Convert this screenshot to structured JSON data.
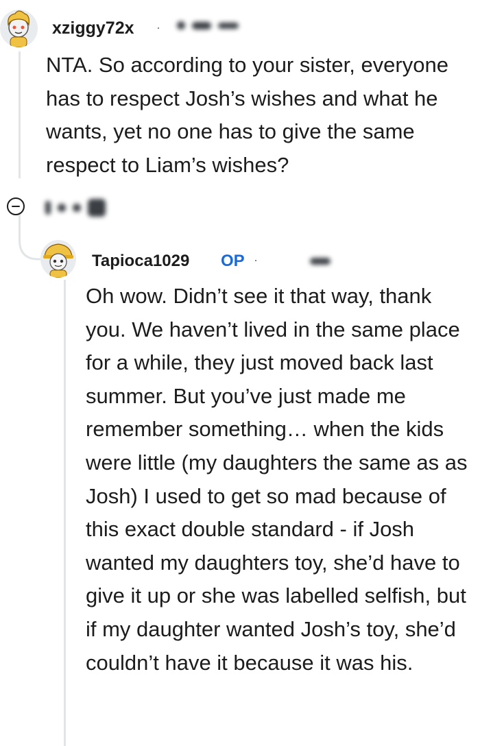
{
  "comment": {
    "username": "xziggy72x",
    "separator": "·",
    "body": "NTA. So according to your sister, everyone has to respect Josh’s wishes and what he wants, yet no one has to give the same respect to Liam’s wishes?"
  },
  "reply": {
    "username": "Tapioca1029",
    "op_badge": "OP",
    "separator": "·",
    "body": "Oh wow. Didn’t see it that way, thank you. We haven’t lived in the same place for a while, they just moved back last summer. But you’ve just made me remember something… when the kids were little (my daughters the same as as Josh) I used to get so mad because of this exact double standard - if Josh wanted my daughters toy, she’d have to give it up or she was labelled selfish, but if my daughter wanted Josh’s toy, she’d couldn’t have it because it was his."
  },
  "colors": {
    "text": "#1c1c1c",
    "op_badge": "#1a6ad9",
    "thread_line": "#e2e5e8",
    "avatar_bg": "#e9ecee"
  },
  "icons": [
    "snoo-avatar-icon",
    "collapse-thread-icon",
    "snoo-avatar-hat-icon"
  ]
}
